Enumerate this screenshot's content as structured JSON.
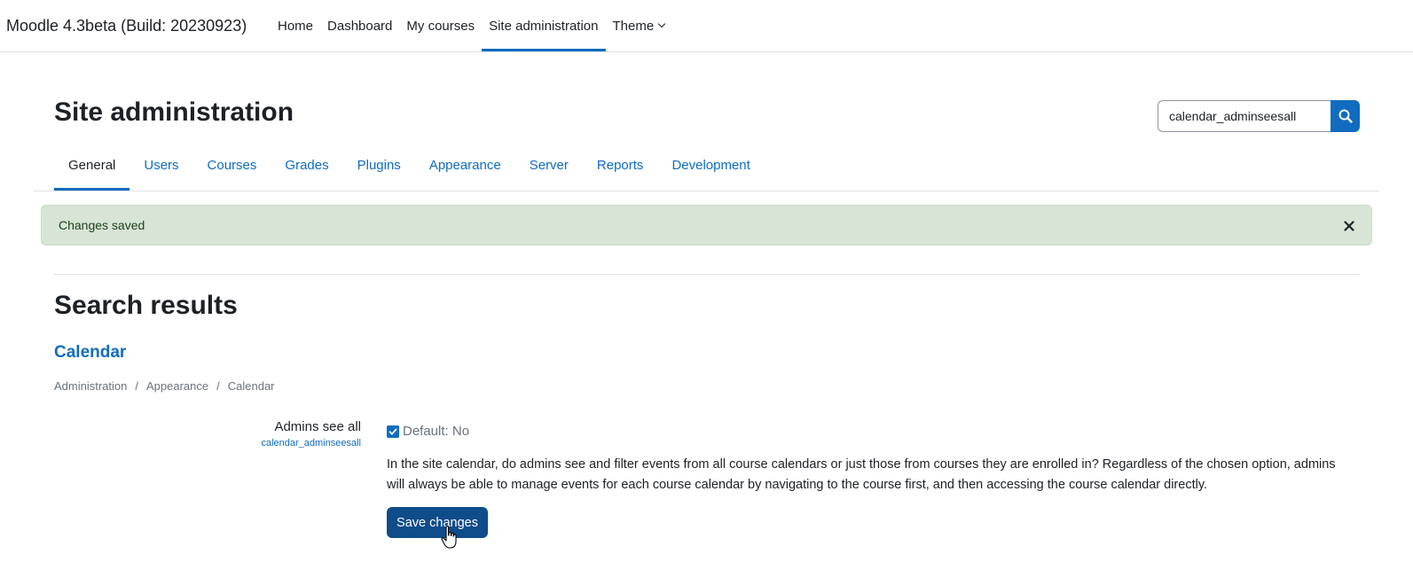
{
  "navbar": {
    "brand": "Moodle 4.3beta (Build: 20230923)",
    "links": [
      {
        "label": "Home"
      },
      {
        "label": "Dashboard"
      },
      {
        "label": "My courses"
      },
      {
        "label": "Site administration",
        "active": true
      },
      {
        "label": "Theme"
      }
    ]
  },
  "header": {
    "title": "Site administration",
    "search": {
      "value": "calendar_adminseesall"
    }
  },
  "tabs": [
    {
      "label": "General",
      "active": true
    },
    {
      "label": "Users"
    },
    {
      "label": "Courses"
    },
    {
      "label": "Grades"
    },
    {
      "label": "Plugins"
    },
    {
      "label": "Appearance"
    },
    {
      "label": "Server"
    },
    {
      "label": "Reports"
    },
    {
      "label": "Development"
    }
  ],
  "alert": {
    "message": "Changes saved"
  },
  "results": {
    "title": "Search results",
    "section": "Calendar",
    "breadcrumb": [
      "Administration",
      "Appearance",
      "Calendar"
    ],
    "breadcrumb_separator": "/",
    "setting": {
      "label": "Admins see all",
      "key": "calendar_adminseesall",
      "checked": true,
      "default_text": "Default: No",
      "description": "In the site calendar, do admins see and filter events from all course calendars or just those from courses they are enrolled in? Regardless of the chosen option, admins will always be able to manage events for each course calendar by navigating to the course first, and then accessing the course calendar directly."
    },
    "save_label": "Save changes"
  },
  "colors": {
    "primary": "#0f6cbf",
    "save_button": "#0f4c8a",
    "alert_bg": "#d7e4d6",
    "text": "#1d2125",
    "muted": "#6a737b"
  },
  "icons": {
    "search": "search-icon",
    "close": "close-icon",
    "dropdown": "chevron-down-icon",
    "checkbox": "check-icon",
    "cursor": "hand-pointer-icon"
  }
}
